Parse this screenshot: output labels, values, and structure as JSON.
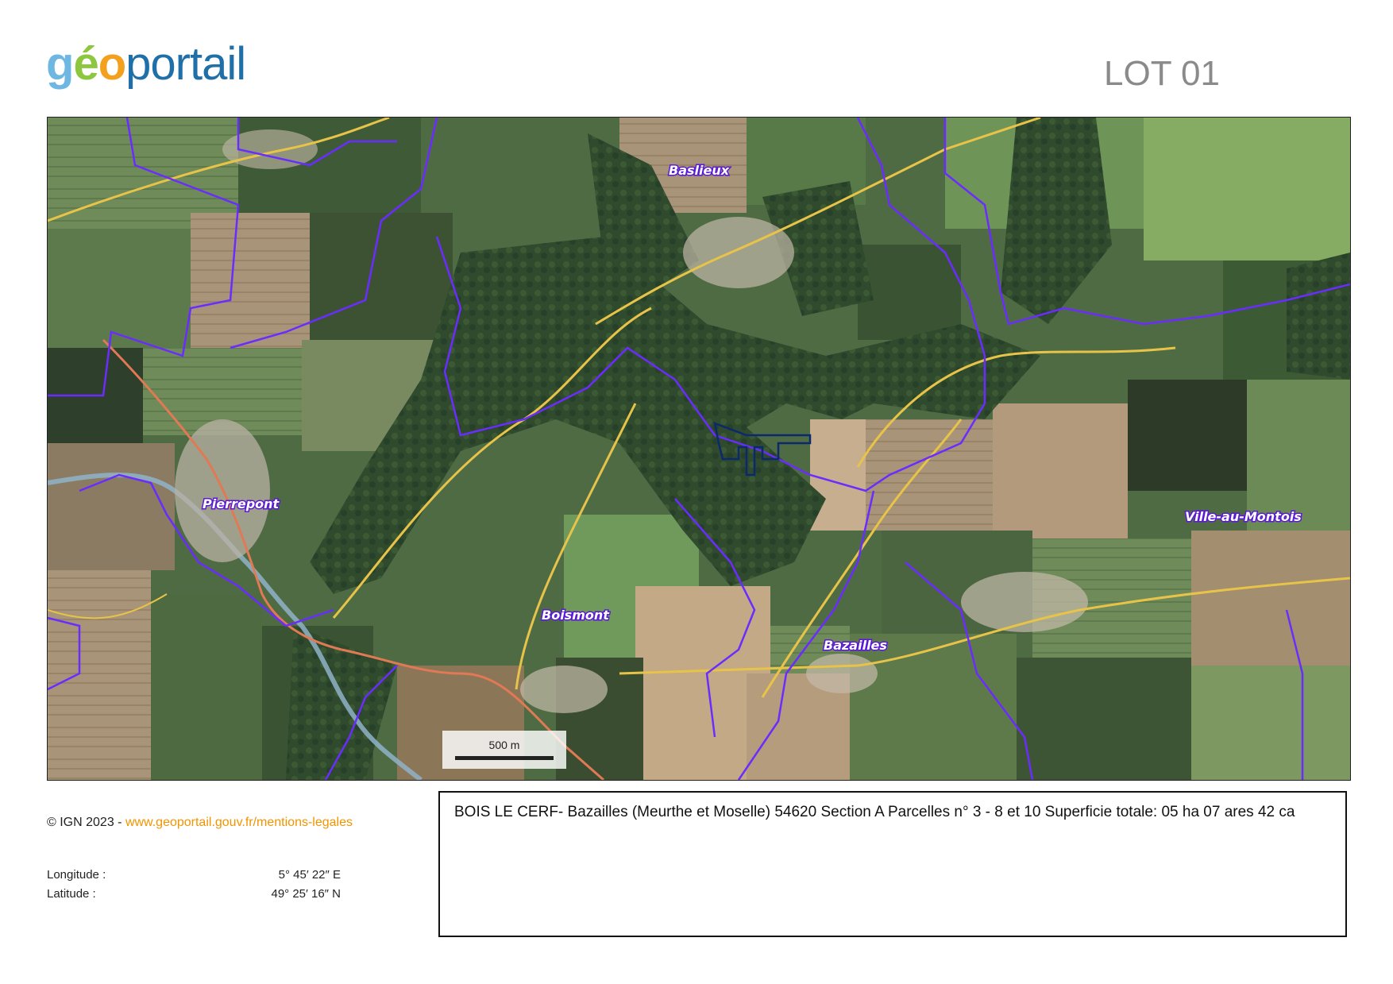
{
  "header": {
    "logo_parts": [
      "g",
      "é",
      "o",
      "portail"
    ],
    "lot_title": "LOT 01"
  },
  "map": {
    "places": [
      "Baslieux",
      "Pierrepont",
      "Ville-au-Montois",
      "Boismont",
      "Bazailles"
    ],
    "scale_label": "500 m",
    "colors": {
      "commune_boundary": "#6a2cff",
      "road_main": "#e8c34a",
      "road_secondary": "#e07a55",
      "parcel_outline": "#0b2a6e",
      "river": "#8fb3c9"
    }
  },
  "footer": {
    "copyright_prefix": "© IGN 2023 - ",
    "copyright_link": "www.geoportail.gouv.fr/mentions-legales",
    "longitude_label": "Longitude :",
    "longitude_value": "5° 45′ 22″ E",
    "latitude_label": "Latitude :",
    "latitude_value": "49° 25′ 16″ N"
  },
  "description": "BOIS LE CERF- Bazailles (Meurthe et Moselle) 54620 Section A Parcelles n° 3 - 8 et 10 Superficie totale: 05 ha 07 ares 42 ca"
}
